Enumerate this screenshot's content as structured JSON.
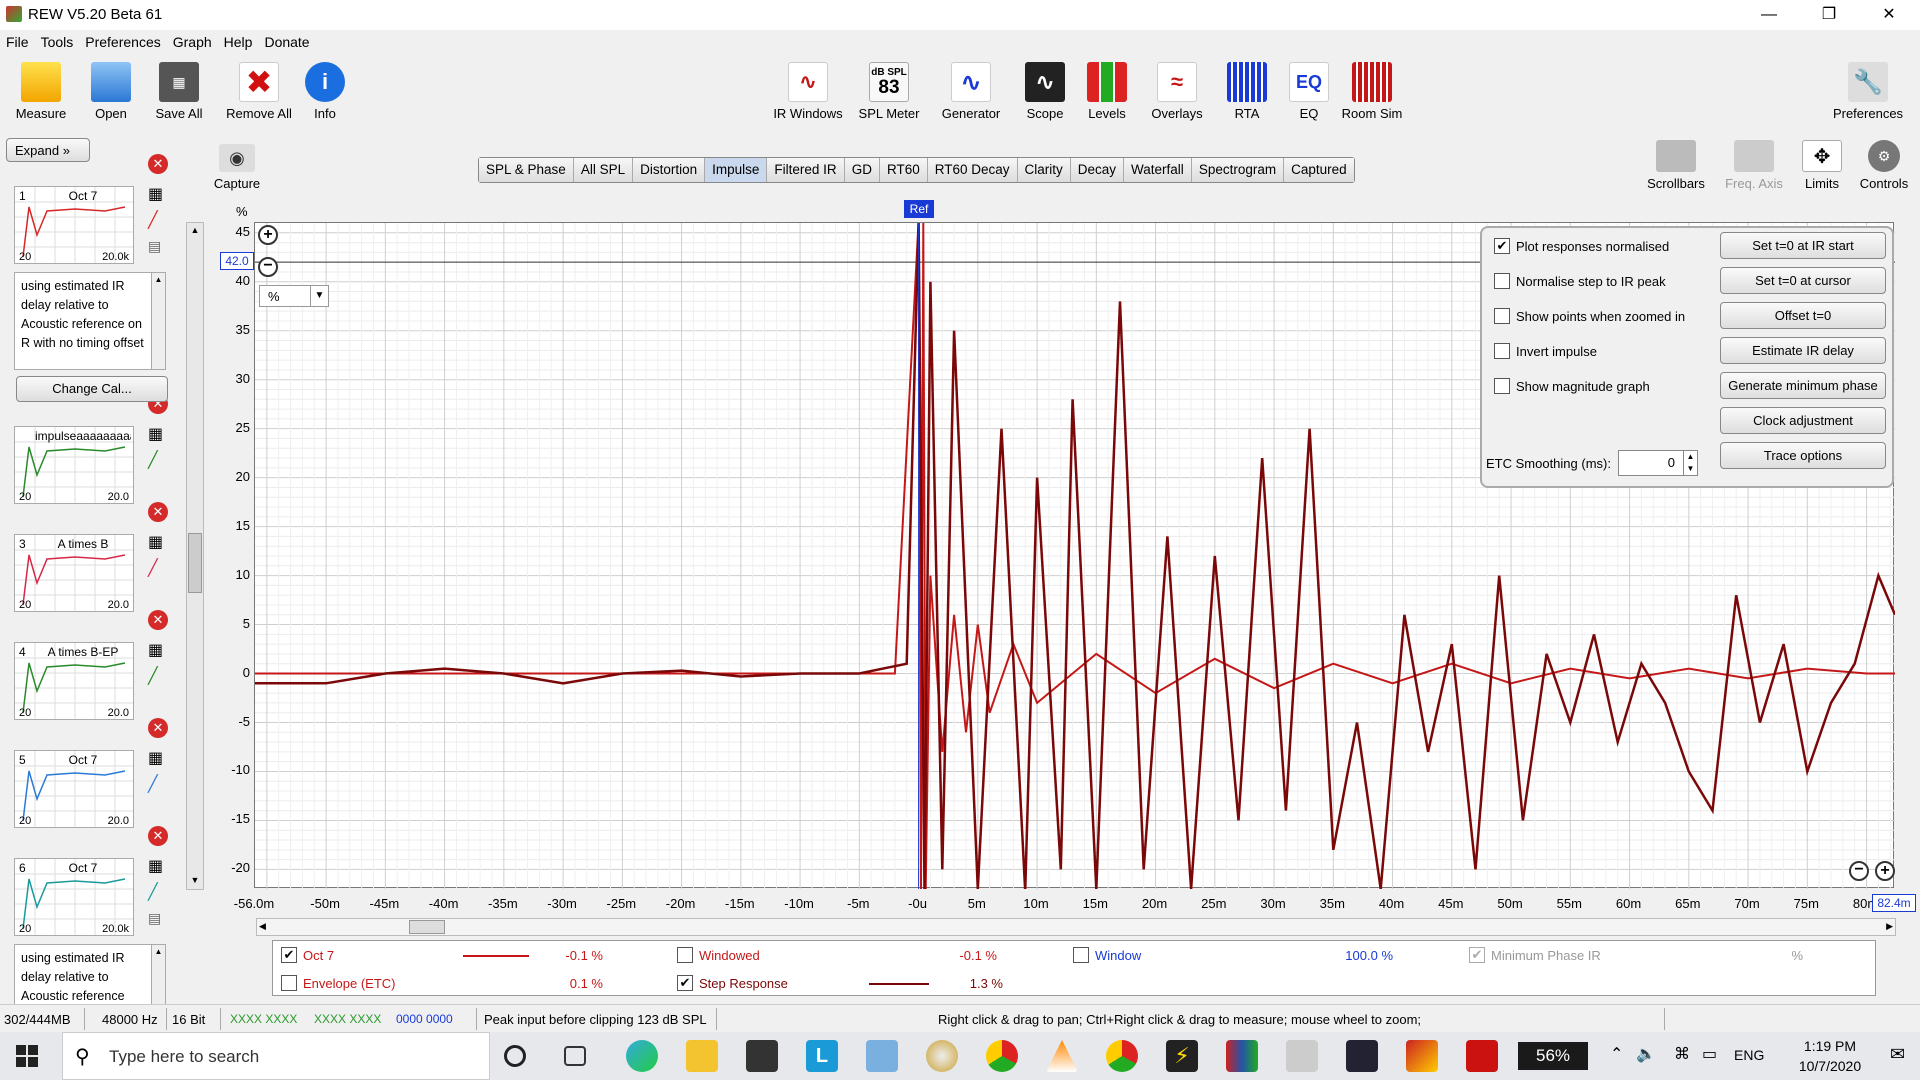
{
  "window": {
    "title": "REW V5.20 Beta 61"
  },
  "menu": [
    "File",
    "Tools",
    "Preferences",
    "Graph",
    "Help",
    "Donate"
  ],
  "toolbar_left": [
    {
      "label": "Measure"
    },
    {
      "label": "Open"
    },
    {
      "label": "Save All"
    },
    {
      "label": "Remove All"
    },
    {
      "label": "Info"
    }
  ],
  "toolbar_center": [
    {
      "label": "IR Windows"
    },
    {
      "label": "SPL Meter",
      "top": "dB SPL",
      "value": "83"
    },
    {
      "label": "Generator"
    },
    {
      "label": "Scope"
    },
    {
      "label": "Levels"
    },
    {
      "label": "Overlays"
    },
    {
      "label": "RTA"
    },
    {
      "label": "EQ",
      "icon_text": "EQ"
    },
    {
      "label": "Room Sim"
    }
  ],
  "toolbar_right": {
    "preferences": "Preferences"
  },
  "graph_toolbar": [
    "Scrollbars",
    "Freq. Axis",
    "Limits",
    "Controls"
  ],
  "capture_label": "Capture",
  "tabs": [
    "SPL & Phase",
    "All SPL",
    "Distortion",
    "Impulse",
    "Filtered IR",
    "GD",
    "RT60",
    "RT60 Decay",
    "Clarity",
    "Decay",
    "Waterfall",
    "Spectrogram",
    "Captured"
  ],
  "selected_tab": "Impulse",
  "left_panel": {
    "expand": "Expand",
    "change_cal": "Change Cal...",
    "measurements": [
      {
        "num": "1",
        "name": "Oct 7",
        "color": "#d62828",
        "notes": "using estimated IR delay relative to Acoustic reference on  R with no timing offset",
        "lo": "20",
        "hi": "20.0k"
      },
      {
        "num": "",
        "name": "impulseaaaaaaaaaaa",
        "color": "#2a8a2a",
        "lo": "20",
        "hi": "20.0"
      },
      {
        "num": "3",
        "name": "A times B",
        "color": "#d62848",
        "lo": "20",
        "hi": "20.0"
      },
      {
        "num": "4",
        "name": "A times B-EP",
        "color": "#2a8a2a",
        "lo": "20",
        "hi": "20.0"
      },
      {
        "num": "5",
        "name": "Oct 7",
        "color": "#2a7ad6",
        "lo": "20",
        "hi": "20.0"
      },
      {
        "num": "6",
        "name": "Oct 7",
        "color": "#1a9a9a",
        "notes": "using estimated IR delay relative to Acoustic reference",
        "lo": "20",
        "hi": "20.0k"
      }
    ]
  },
  "graph": {
    "y_unit": "%",
    "y_cursor": "42.0",
    "x_cursor": "82.4m",
    "unit_select": "%",
    "ref_label": "Ref",
    "y_ticks": [
      "45",
      "40",
      "35",
      "30",
      "25",
      "20",
      "15",
      "10",
      "5",
      "0",
      "-5",
      "-10",
      "-15",
      "-20"
    ],
    "x_ticks": [
      "-56.0m",
      "-50m",
      "-45m",
      "-40m",
      "-35m",
      "-30m",
      "-25m",
      "-20m",
      "-15m",
      "-10m",
      "-5m",
      "-0u",
      "5m",
      "10m",
      "15m",
      "20m",
      "25m",
      "30m",
      "35m",
      "40m",
      "45m",
      "50m",
      "55m",
      "60m",
      "65m",
      "70m",
      "75m",
      "80m"
    ]
  },
  "chart_data": {
    "type": "line",
    "xlabel": "",
    "ylabel": "%",
    "xlim": [
      -56,
      82.4
    ],
    "ylim": [
      -22,
      46
    ],
    "series": [
      {
        "name": "Oct 7",
        "color": "#c41818",
        "x": [
          -56,
          -50,
          -40,
          -30,
          -20,
          -10,
          -2,
          0,
          0.2,
          0.4,
          0.6,
          1,
          2,
          3,
          4,
          5,
          6,
          8,
          10,
          15,
          20,
          25,
          30,
          35,
          40,
          45,
          50,
          55,
          60,
          65,
          70,
          75,
          80,
          82.4
        ],
        "y": [
          0,
          0,
          0,
          0,
          0,
          0,
          0,
          100,
          -30,
          60,
          -25,
          10,
          -8,
          6,
          -6,
          5,
          -4,
          3,
          -3,
          2,
          -2,
          1.5,
          -1.5,
          1,
          -1,
          1,
          -1,
          0.5,
          -0.5,
          0.5,
          -0.5,
          0.5,
          0,
          0
        ]
      },
      {
        "name": "Step Response",
        "color": "#7a0808",
        "x": [
          -56,
          -50,
          -45,
          -40,
          -35,
          -30,
          -25,
          -20,
          -15,
          -10,
          -5,
          -1,
          0,
          0.5,
          1,
          2,
          3,
          5,
          7,
          9,
          10,
          12,
          13,
          15,
          17,
          19,
          21,
          23,
          25,
          27,
          29,
          31,
          33,
          35,
          37,
          39,
          41,
          43,
          45,
          47,
          49,
          51,
          53,
          55,
          57,
          59,
          61,
          63,
          65,
          67,
          69,
          71,
          73,
          75,
          77,
          79,
          81,
          82.4
        ],
        "y": [
          -1,
          -1,
          0,
          0.5,
          0,
          -1,
          0,
          0.3,
          -0.3,
          0,
          0,
          1,
          60,
          -25,
          40,
          -20,
          35,
          -22,
          25,
          -25,
          20,
          -20,
          28,
          -22,
          38,
          -20,
          14,
          -22,
          12,
          -15,
          22,
          -14,
          25,
          -18,
          -5,
          -22,
          6,
          -8,
          3,
          -20,
          10,
          -15,
          2,
          -5,
          4,
          -7,
          1,
          -3,
          -10,
          -14,
          8,
          -5,
          3,
          -10,
          -3,
          1,
          10,
          6
        ]
      }
    ]
  },
  "controls": {
    "checkboxes": [
      {
        "label": "Plot responses normalised",
        "checked": true
      },
      {
        "label": "Normalise step to IR peak",
        "checked": false
      },
      {
        "label": "Show points when zoomed in",
        "checked": false
      },
      {
        "label": "Invert impulse",
        "checked": false
      },
      {
        "label": "Show magnitude graph",
        "checked": false
      }
    ],
    "buttons": [
      "Set t=0 at IR start",
      "Set t=0 at cursor",
      "Offset t=0",
      "Estimate IR delay",
      "Generate minimum phase",
      "Clock adjustment",
      "Trace options"
    ],
    "etc_label": "ETC Smoothing (ms):",
    "etc_value": "0"
  },
  "legend": [
    {
      "label": "Oct 7",
      "value": "-0.1 %",
      "checked": true,
      "color": "#c41818",
      "active": true
    },
    {
      "label": "Windowed",
      "value": "-0.1 %",
      "checked": false,
      "color": "#c41818",
      "active": false
    },
    {
      "label": "Window",
      "value": "100.0 %",
      "checked": false,
      "color": "#1a3ad6",
      "active": false
    },
    {
      "label": "Minimum Phase IR",
      "value": "%",
      "checked": true,
      "color": "#999999",
      "active": false
    },
    {
      "label": "Envelope (ETC)",
      "value": "0.1 %",
      "checked": false,
      "color": "#c41818",
      "active": false
    },
    {
      "label": "Step Response",
      "value": "1.3 %",
      "checked": true,
      "color": "#7a0808",
      "active": true
    }
  ],
  "status": {
    "memory": "302/444MB",
    "rate": "48000 Hz",
    "bits": "16 Bit",
    "g1": "XXXX XXXX",
    "g2": "XXXX XXXX",
    "b1": "0000 0000",
    "peak": "Peak input before clipping 123 dB SPL",
    "hint": "Right click & drag to pan; Ctrl+Right click & drag to measure; mouse wheel to zoom;"
  },
  "taskbar": {
    "search": "Type here to search",
    "battery": "56%",
    "lang": "ENG",
    "time": "1:19 PM",
    "date": "10/7/2020"
  }
}
